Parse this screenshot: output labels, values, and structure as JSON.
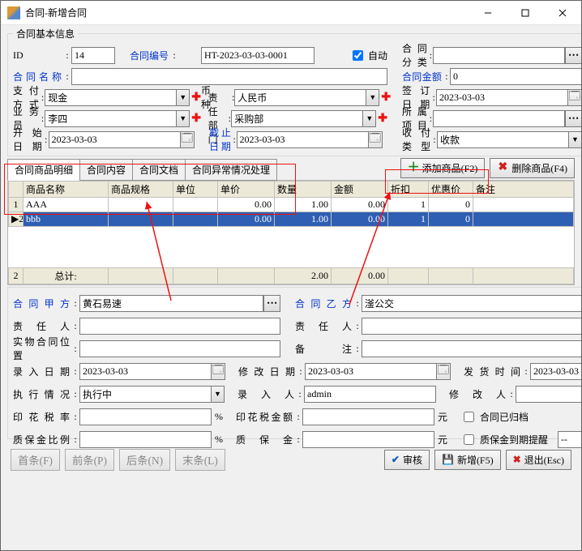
{
  "window": {
    "title": "合同-新增合同"
  },
  "groupTitle": "合同基本信息",
  "labels": {
    "id": "ID",
    "contract_no": "合同编号",
    "auto": "自动",
    "category": "合同分类",
    "name": "合同名称",
    "amount": "合同金额",
    "pay_method": "支付方式",
    "currency": "币　　种",
    "sign_date": "签订日期",
    "salesman": "业 务 员",
    "dept": "责任部门",
    "project": "所属项目",
    "start_date": "开始日期",
    "end_date": "截止日期",
    "collect_type": "收付类型"
  },
  "values": {
    "id": "14",
    "contract_no": "HT-2023-03-03-0001",
    "auto_checked": true,
    "category": "",
    "name": "",
    "amount": "0",
    "pay_method": "现金",
    "currency": "人民币",
    "sign_date": "2023-03-03",
    "salesman": "李四",
    "dept": "采购部",
    "project": "",
    "start_date": "2023-03-03",
    "end_date": "2023-03-03",
    "collect_type": "收款"
  },
  "tabs": [
    "合同商品明细",
    "合同内容",
    "合同文档",
    "合同异常情况处理"
  ],
  "tabButtons": {
    "add": "添加商品(F2)",
    "delete": "删除商品(F4)"
  },
  "gridHeaders": [
    "商品名称",
    "商品规格",
    "单位",
    "单价",
    "数量",
    "金额",
    "折扣",
    "优惠价",
    "备注"
  ],
  "gridRows": [
    {
      "name": "AAA",
      "spec": "",
      "unit": "",
      "price": "0.00",
      "qty": "1.00",
      "amount": "0.00",
      "discount": "1",
      "coupon": "0",
      "remark": ""
    },
    {
      "name": "bbb",
      "spec": "",
      "unit": "",
      "price": "0.00",
      "qty": "1.00",
      "amount": "0.00",
      "discount": "1",
      "coupon": "0",
      "remark": ""
    }
  ],
  "gridTotal": {
    "label": "总计:",
    "count": "2",
    "qty": "2.00",
    "amount": "0.00"
  },
  "lower": {
    "labels": {
      "party_a": "合同甲方",
      "party_b": "合同乙方",
      "resp_a": "责 任 人",
      "resp_b": "责 任 人",
      "physical_loc": "实物合同位置",
      "remark": "备　　注",
      "entry_date": "录入日期",
      "modify_date": "修改日期",
      "ship_date": "发货时间",
      "exec_status": "执行情况",
      "entry_by": "录 入 人",
      "modify_by": "修 改 人",
      "stamp_rate": "印花税率",
      "stamp_amount": "印花税金额",
      "archived": "合同已归档",
      "deposit_ratio": "质保金比例",
      "deposit": "质 保 金",
      "deposit_remind": "质保金到期提醒",
      "pct": "%",
      "yuan": "元"
    },
    "values": {
      "party_a": "黄石易速",
      "party_b": "滏公交",
      "resp_a": "",
      "resp_b": "",
      "physical_loc": "",
      "remark": "",
      "entry_date": "2023-03-03",
      "modify_date": "2023-03-03",
      "ship_date": "2023-03-03",
      "exec_status": "执行中",
      "entry_by": "admin",
      "modify_by": "",
      "stamp_rate": "",
      "stamp_amount": "",
      "archived": false,
      "deposit_ratio": "",
      "deposit": "",
      "deposit_remind": "--"
    }
  },
  "navButtons": {
    "first": "首条(F)",
    "prev": "前条(P)",
    "next": "后条(N)",
    "last": "末条(L)"
  },
  "actionButtons": {
    "audit": "审核",
    "new": "新增(F5)",
    "exit": "退出(Esc)"
  }
}
